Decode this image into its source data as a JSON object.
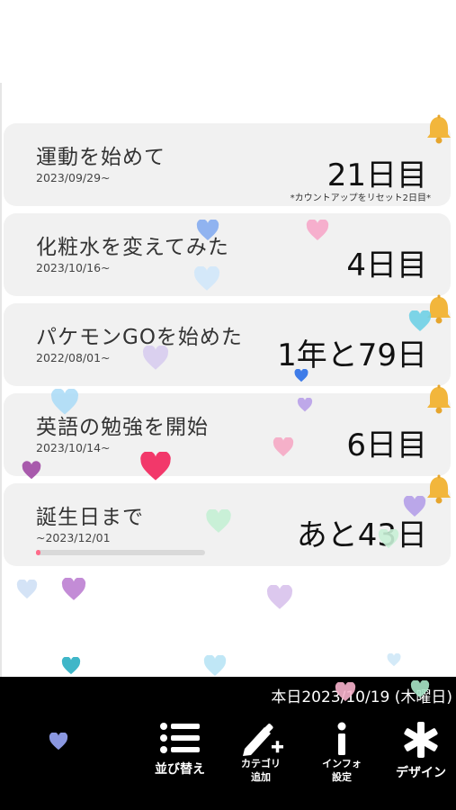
{
  "cards": [
    {
      "title": "運動を始めて",
      "date": "2023/09/29~",
      "count": "21日目",
      "note": "*カウントアップをリセット2日目*",
      "bell": true
    },
    {
      "title": "化粧水を変えてみた",
      "date": "2023/10/16~",
      "count": "4日目",
      "bell": false
    },
    {
      "title": "パケモンGOを始めた",
      "date": "2022/08/01~",
      "count": "1年と79日",
      "bell": true
    },
    {
      "title": "英語の勉強を開始",
      "date": "2023/10/14~",
      "count": "6日目",
      "bell": true
    },
    {
      "title": "誕生日まで",
      "date": "~2023/12/01",
      "count": "あと43日",
      "bell": true,
      "progress": 0.02
    }
  ],
  "bottom_bar": {
    "today": "本日2023/10/19 (木曜日)",
    "buttons": [
      {
        "label": "並び替え",
        "icon": "list-icon"
      },
      {
        "label_line1": "カテゴリ",
        "label_line2": "追加",
        "icon": "pencil-plus-icon"
      },
      {
        "label_line1": "インフォ",
        "label_line2": "設定",
        "icon": "info-icon"
      },
      {
        "label": "デザイン",
        "icon": "asterisk-icon"
      }
    ]
  },
  "colors": {
    "card_bg": "#f1f1f1",
    "bell": "#f2b63c",
    "bar_bg": "#000000",
    "progress": "#ff6b8a"
  }
}
